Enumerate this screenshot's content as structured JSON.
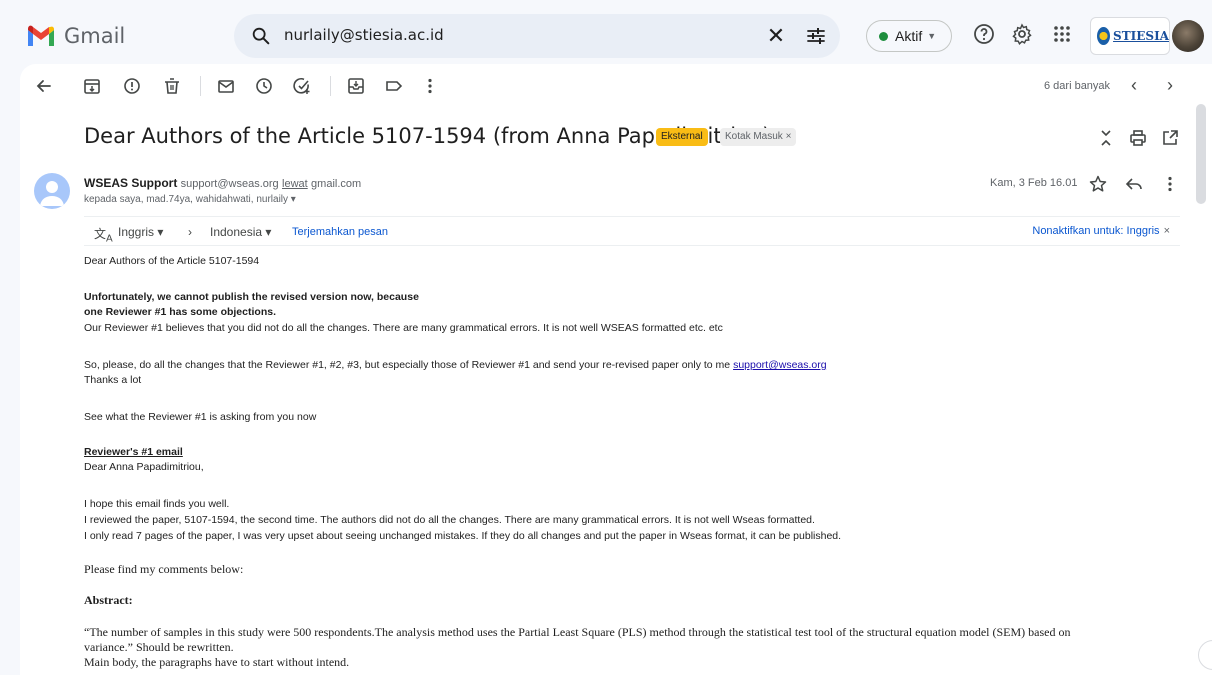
{
  "app": {
    "name": "Gmail"
  },
  "search": {
    "value": "nurlaily@stiesia.ac.id"
  },
  "status": {
    "label": "Aktif"
  },
  "account": {
    "logo_text": "STIESIA"
  },
  "toolbar": {
    "pager": "6 dari banyak"
  },
  "email": {
    "subject": "Dear Authors of the Article 5107-1594 (from Anna Papadimitriou)",
    "labels": [
      "Eksternal",
      "Kotak Masuk"
    ],
    "sender_name": "WSEAS Support",
    "sender_email": "support@wseas.org",
    "via_label": "lewat",
    "via_domain": "gmail.com",
    "recipients": "kepada saya, mad.74ya, wahidahwati, nurlaily",
    "date": "Kam, 3 Feb 16.01"
  },
  "translate": {
    "from_lang": "Inggris",
    "to_lang": "Indonesia",
    "action": "Terjemahkan pesan",
    "disable": "Nonaktifkan untuk: Inggris"
  },
  "body": {
    "l1": "Dear Authors of the Article  5107-1594",
    "l2": "Unfortunately, we cannot publish the revised version now, because",
    "l3": "one  Reviewer #1  has some objections.",
    "l4": "Our Reviewer #1 believes that you did not do all the changes. There are many grammatical errors. It is not well WSEAS formatted etc. etc",
    "l5": "So, please, do all the changes that the Reviewer #1, #2, #3, but especially those of Reviewer #1 and send your re-revised paper only to me ",
    "l5_link": "support@wseas.org",
    "l6": "Thanks a lot",
    "l7": "See what the Reviewer #1 is asking from you now",
    "l8": "Reviewer's #1 email",
    "l9": "Dear Anna Papadimitriou,",
    "l10": "I hope this email finds you well.",
    "l11": "I reviewed the paper, 5107-1594, the second time. The authors did not do all the changes. There are many grammatical errors. It is not well Wseas formatted.",
    "l12": "I only read 7 pages of the paper, I was very upset about seeing unchanged mistakes.  If they do all changes and put the paper in Wseas format, it can be published.",
    "l13": "Please find my comments below:",
    "l14": "Abstract:",
    "l15": "“The number of samples in this study were 500 respondents.The analysis method uses the Partial Least Square (PLS) method through the statistical test tool of the structural equation model (SEM) based on",
    "l16": "variance.” Should be rewritten.",
    "l17": "Main body, the paragraphs have to start without intend."
  }
}
